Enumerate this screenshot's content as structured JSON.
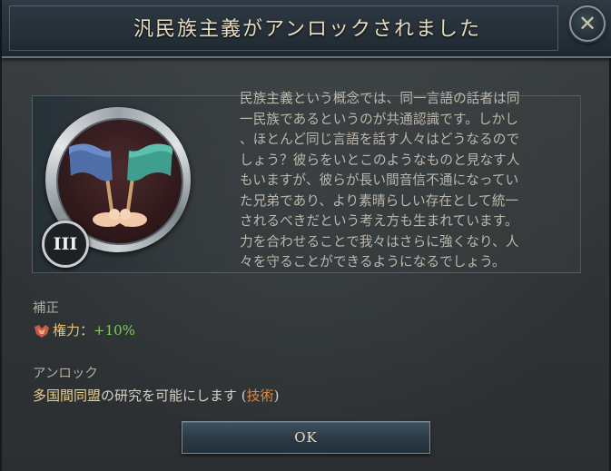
{
  "dialog": {
    "title": "汎民族主義がアンロックされました",
    "close_label": "✕",
    "tier": "III",
    "description": "民族主義という概念では、同一言語の話者は同\n一民族であるというのが共通認識です。しかし\n、ほとんど同じ言語を話す人々はどうなるので\nしょう？彼らをいとこのようなものと見なす人\nもいますが、彼らが長い間音信不通になってい\nた兄弟であり、より素晴らしい存在として統一\nされるべきだという考え方も生まれています。\n力を合わせることで我々はさらに強くなり、人\n々を守ることができるようになるでしょう。",
    "modifier_label": "補正",
    "modifier": {
      "name": "権力",
      "separator": "：",
      "value": "+10%"
    },
    "unlock_label": "アンロック",
    "unlock": {
      "item": "多国間同盟",
      "text": "の研究を可能にします (",
      "category": "技術",
      "close": ")"
    },
    "ok_label": "OK"
  },
  "colors": {
    "title_text": "#e8dcc0",
    "modifier_name": "#e6c36a",
    "modifier_value": "#7fcf5a",
    "tech_highlight": "#e0893a",
    "button_bg": "#2a3944"
  },
  "icons": {
    "emblem": "flags-handshake-icon",
    "modifier": "power-icon",
    "close": "close-icon"
  }
}
